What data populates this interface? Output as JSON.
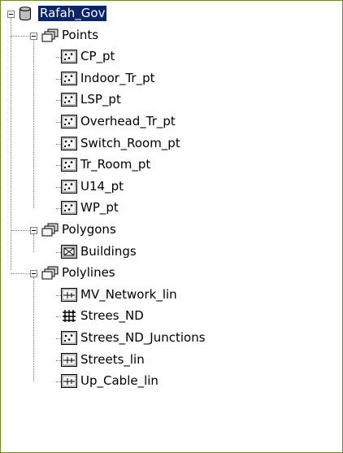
{
  "root": {
    "label": "Rafah_Gov",
    "icon": "database-icon",
    "selected": true
  },
  "groups": [
    {
      "label": "Points",
      "icon": "feature-dataset-icon",
      "children": [
        {
          "label": "CP_pt",
          "icon": "point-feature-class-icon"
        },
        {
          "label": "Indoor_Tr_pt",
          "icon": "point-feature-class-icon"
        },
        {
          "label": "LSP_pt",
          "icon": "point-feature-class-icon"
        },
        {
          "label": "Overhead_Tr_pt",
          "icon": "point-feature-class-icon"
        },
        {
          "label": "Switch_Room_pt",
          "icon": "point-feature-class-icon"
        },
        {
          "label": "Tr_Room_pt",
          "icon": "point-feature-class-icon"
        },
        {
          "label": "U14_pt",
          "icon": "point-feature-class-icon"
        },
        {
          "label": "WP_pt",
          "icon": "point-feature-class-icon"
        }
      ]
    },
    {
      "label": "Polygons",
      "icon": "feature-dataset-icon",
      "children": [
        {
          "label": "Buildings",
          "icon": "polygon-feature-class-icon"
        }
      ]
    },
    {
      "label": "Polylines",
      "icon": "feature-dataset-icon",
      "children": [
        {
          "label": "MV_Network_lin",
          "icon": "line-feature-class-icon"
        },
        {
          "label": "Strees_ND",
          "icon": "network-dataset-icon"
        },
        {
          "label": "Strees_ND_Junctions",
          "icon": "point-feature-class-icon"
        },
        {
          "label": "Streets_lin",
          "icon": "line-feature-class-icon"
        },
        {
          "label": "Up_Cable_lin",
          "icon": "line-feature-class-icon"
        }
      ]
    }
  ]
}
